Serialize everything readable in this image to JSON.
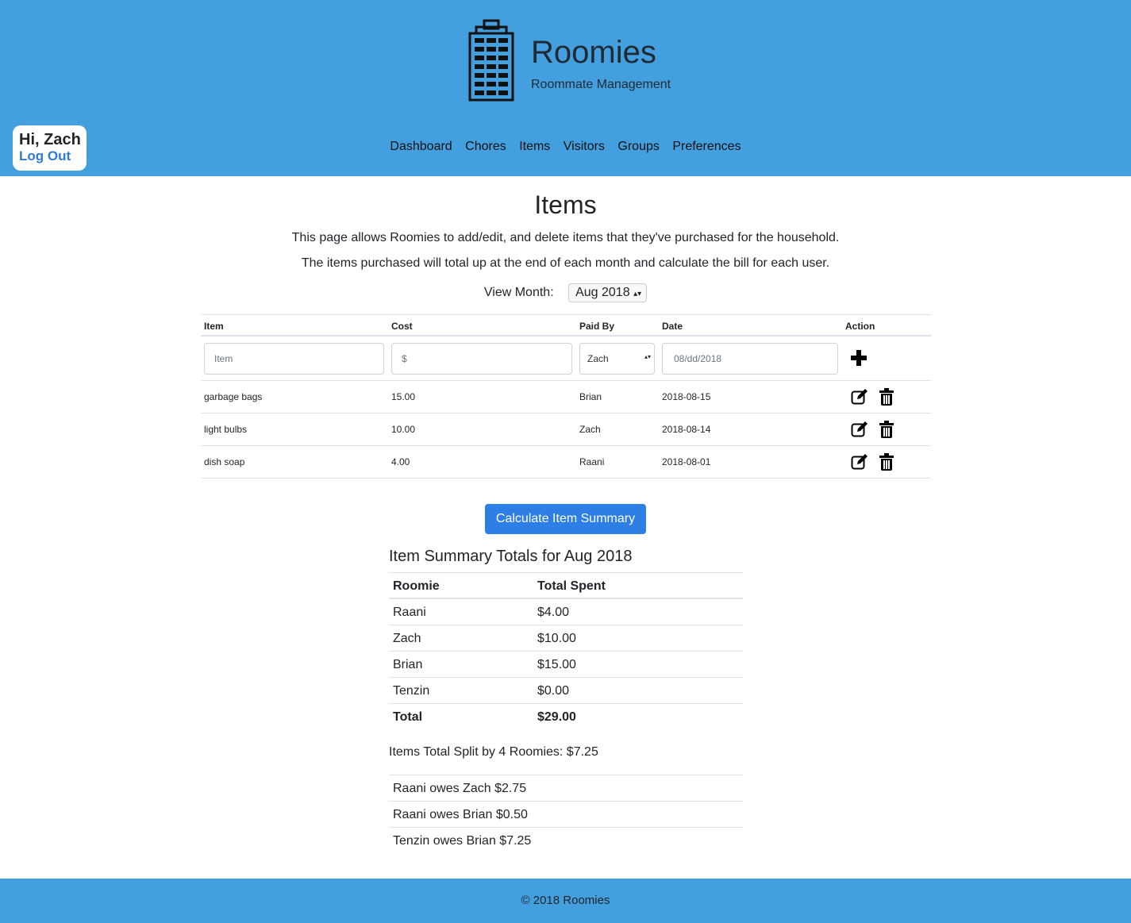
{
  "brand": {
    "title": "Roomies",
    "subtitle": "Roommate Management"
  },
  "user": {
    "greeting": "Hi, Zach",
    "logout": "Log Out"
  },
  "nav": [
    "Dashboard",
    "Chores",
    "Items",
    "Visitors",
    "Groups",
    "Preferences"
  ],
  "page": {
    "title": "Items",
    "desc1": "This page allows Roomies to add/edit, and delete items that they've purchased for the household.",
    "desc2": "The items purchased will total up at the end of each month and calculate the bill for each user.",
    "month_label": "View Month:",
    "month_value": "Aug 2018"
  },
  "items_table": {
    "headers": [
      "Item",
      "Cost",
      "Paid By",
      "Date",
      "Action"
    ],
    "input": {
      "item_placeholder": "Item",
      "cost_placeholder": "$",
      "paid_by": "Zach",
      "date": "08/dd/2018"
    },
    "rows": [
      {
        "item": "garbage bags",
        "cost": "15.00",
        "paid_by": "Brian",
        "date": "2018-08-15"
      },
      {
        "item": "light bulbs",
        "cost": "10.00",
        "paid_by": "Zach",
        "date": "2018-08-14"
      },
      {
        "item": "dish soap",
        "cost": "4.00",
        "paid_by": "Raani",
        "date": "2018-08-01"
      }
    ]
  },
  "calc_button": "Calculate Item Summary",
  "summary": {
    "title": "Item Summary Totals for Aug 2018",
    "headers": [
      "Roomie",
      "Total Spent"
    ],
    "rows": [
      {
        "roomie": "Raani",
        "total": "$4.00"
      },
      {
        "roomie": "Zach",
        "total": "$10.00"
      },
      {
        "roomie": "Brian",
        "total": "$15.00"
      },
      {
        "roomie": "Tenzin",
        "total": "$0.00"
      }
    ],
    "total_label": "Total",
    "total_value": "$29.00",
    "split": "Items Total Split by 4 Roomies: $7.25",
    "owes": [
      "Raani owes Zach $2.75",
      "Raani owes Brian $0.50",
      "Tenzin owes Brian $7.25"
    ]
  },
  "footer": "© 2018 Roomies",
  "icons": {
    "logo": "building-icon",
    "add": "plus-icon",
    "edit": "edit-icon",
    "delete": "trash-icon"
  },
  "colors": {
    "header": "#449fdf",
    "button": "#2e7fe5",
    "link": "#2a7bd4"
  }
}
